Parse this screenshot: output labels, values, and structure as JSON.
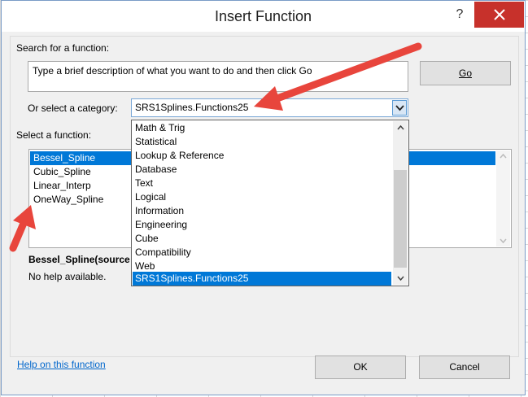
{
  "dialog": {
    "title": "Insert Function",
    "help_symbol": "?"
  },
  "search": {
    "label": "Search for a function:",
    "value": "Type a brief description of what you want to do and then click Go",
    "go_label": "Go"
  },
  "category": {
    "label": "Or select a category:",
    "selected": "SRS1Splines.Functions25",
    "options": [
      "Math & Trig",
      "Statistical",
      "Lookup & Reference",
      "Database",
      "Text",
      "Logical",
      "Information",
      "Engineering",
      "Cube",
      "Compatibility",
      "Web",
      "SRS1Splines.Functions25"
    ]
  },
  "functions": {
    "label": "Select a function:",
    "items": [
      "Bessel_Spline",
      "Cubic_Spline",
      "Linear_Interp",
      "OneWay_Spline"
    ],
    "signature": "Bessel_Spline(source",
    "help_text": "No help available."
  },
  "footer": {
    "help_link": "Help on this function",
    "ok_label": "OK",
    "cancel_label": "Cancel"
  },
  "colors": {
    "selection": "#0078d7",
    "close_button": "#c7312b",
    "annotation_arrow": "#e8453c",
    "link": "#0066cc"
  }
}
